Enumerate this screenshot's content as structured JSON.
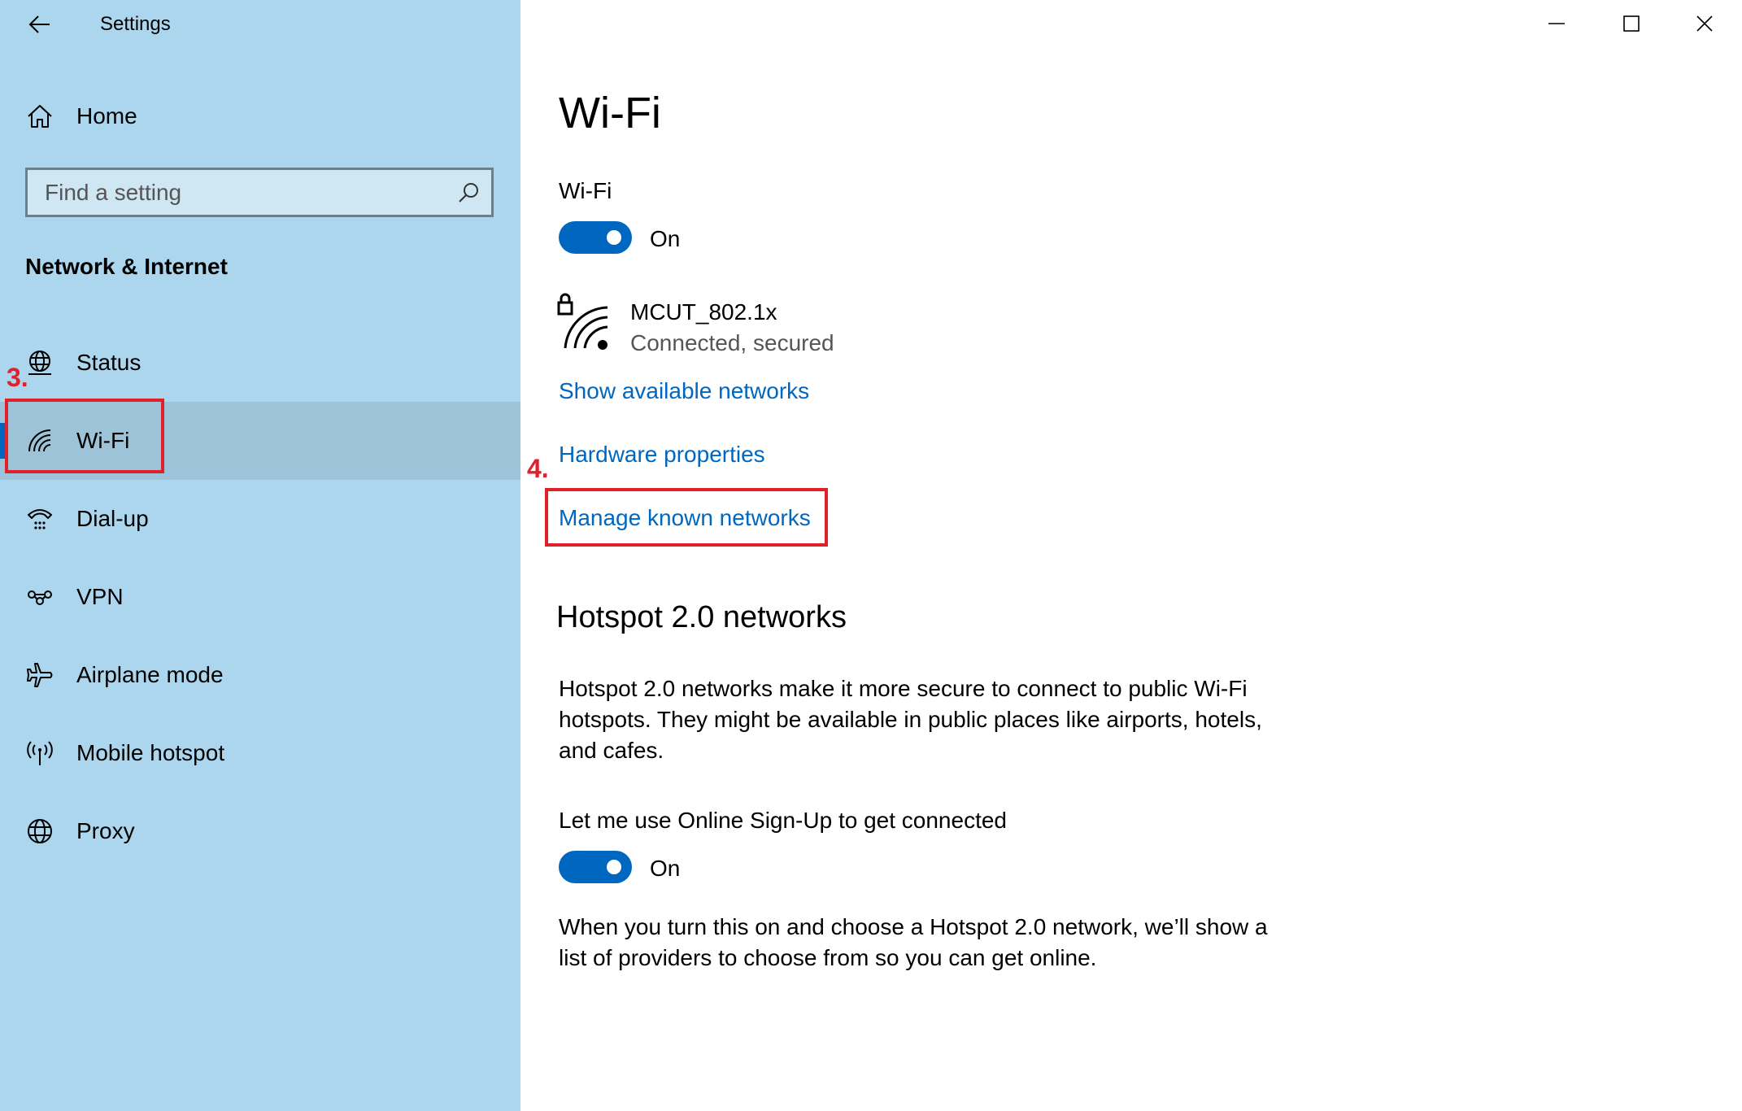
{
  "window": {
    "title": "Settings"
  },
  "sidebar": {
    "home_label": "Home",
    "search_placeholder": "Find a setting",
    "section_title": "Network & Internet",
    "items": [
      {
        "label": "Status",
        "icon": "globe-status-icon"
      },
      {
        "label": "Wi-Fi",
        "icon": "wifi-icon",
        "selected": true
      },
      {
        "label": "Dial-up",
        "icon": "dial-up-icon"
      },
      {
        "label": "VPN",
        "icon": "vpn-icon"
      },
      {
        "label": "Airplane mode",
        "icon": "airplane-icon"
      },
      {
        "label": "Mobile hotspot",
        "icon": "mobile-hotspot-icon"
      },
      {
        "label": "Proxy",
        "icon": "globe-proxy-icon"
      }
    ]
  },
  "annotations": {
    "step3": "3.",
    "step4": "4."
  },
  "main": {
    "title": "Wi-Fi",
    "wifi_label": "Wi-Fi",
    "wifi_toggle_state": "On",
    "network": {
      "name": "MCUT_802.1x",
      "status": "Connected, secured"
    },
    "links": {
      "show_networks": "Show available networks",
      "hardware": "Hardware properties",
      "manage": "Manage known networks"
    },
    "hotspot": {
      "title": "Hotspot 2.0 networks",
      "description_1": "Hotspot 2.0 networks make it more secure to connect to public Wi-Fi",
      "description_2": "hotspots. They might be available in public places like airports, hotels,",
      "description_3": "and cafes.",
      "signup_label": "Let me use Online Sign-Up to get connected",
      "signup_toggle_state": "On",
      "footer_1": "When you turn this on and choose a Hotspot 2.0 network, we’ll show a",
      "footer_2": "list of providers to choose from so you can get online."
    }
  },
  "colors": {
    "sidebar_bg": "#acd6ed",
    "accent": "#0067c0",
    "annotation": "#e0202a"
  }
}
